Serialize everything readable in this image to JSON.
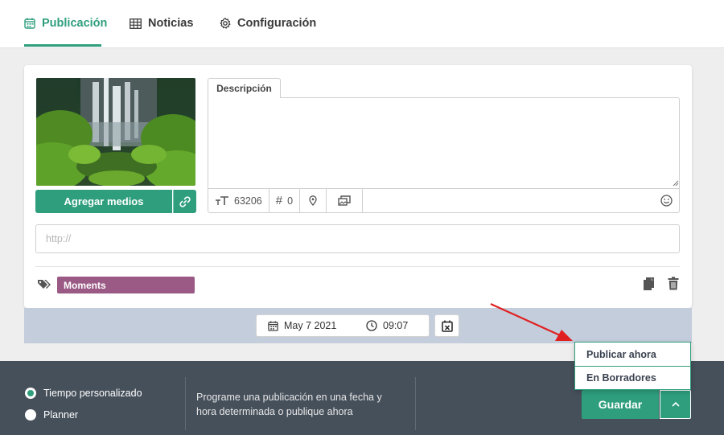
{
  "tabs": [
    {
      "label": "Publicación",
      "icon": "calendar-icon"
    },
    {
      "label": "Noticias",
      "icon": "grid-icon"
    },
    {
      "label": "Configuración",
      "icon": "gear-icon"
    }
  ],
  "media": {
    "add_label": "Agregar medios",
    "link_icon": "link-icon"
  },
  "description": {
    "tab_label": "Descripción",
    "value": "",
    "char_count": "63206",
    "hashtag_count": "0"
  },
  "url": {
    "placeholder": "http://",
    "value": ""
  },
  "tags": {
    "items": [
      "Moments"
    ],
    "color": "#9a5a85"
  },
  "schedule": {
    "date": "May 7 2021",
    "time": "09:07"
  },
  "bottom": {
    "options": [
      {
        "label": "Tiempo personalizado",
        "checked": true
      },
      {
        "label": "Planner",
        "checked": false
      }
    ],
    "help": "Programe una publicación en una fecha y hora determinada o publique ahora",
    "save_label": "Guardar"
  },
  "dropdown": {
    "items": [
      "Publicar ahora",
      "En Borradores"
    ]
  },
  "colors": {
    "accent": "#2e9e7d",
    "bottombar": "#46505b",
    "strip": "#c4cddb",
    "arrow": "#e02020"
  }
}
